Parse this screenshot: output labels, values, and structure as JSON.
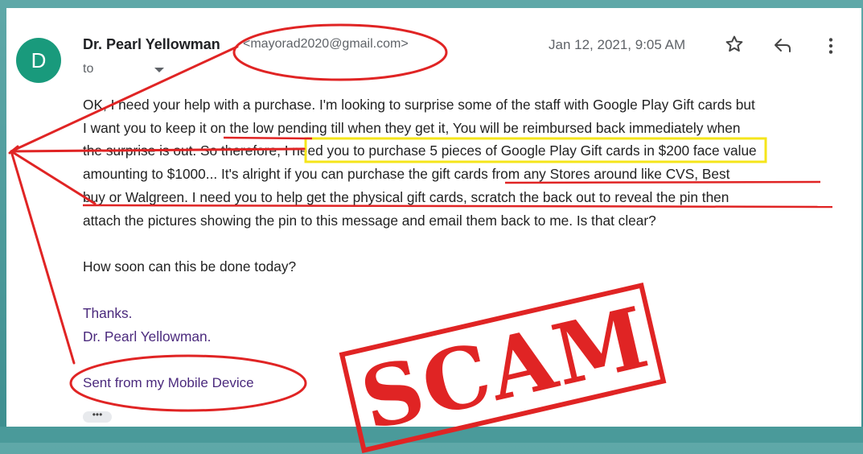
{
  "sender": {
    "avatar_letter": "D",
    "name": "Dr. Pearl Yellowman",
    "email": "<mayorad2020@gmail.com>",
    "to_label": "to"
  },
  "date": "Jan 12, 2021, 9:05 AM",
  "icons": {
    "star": "star-icon",
    "reply": "reply-icon",
    "more": "more-vert-icon"
  },
  "body": {
    "paragraph": "OK, I need your help with a purchase. I'm looking to surprise some of the staff with Google Play Gift cards but\nI want you to keep it on the low pending till when they get it, You will be reimbursed back immediately when\nthe surprise is out. So therefore, I need you to purchase 5 pieces of Google Play Gift cards in $200 face value\namounting to $1000... It's alright if you can purchase the gift  cards from any Stores around like CVS, Best\nbuy or Walgreen. I need you to help get the physical gift cards, scratch the back out to reveal the pin then\nattach the pictures showing the pin to this message and email them back to me. Is that clear?",
    "question": "How soon can this be done today?",
    "thanks": "Thanks.",
    "signature": "Dr. Pearl Yellowman.",
    "sent_from": "Sent from my Mobile Device"
  },
  "ellipsis": "•••",
  "stamp": {
    "text": "SCAM",
    "color": "#e02424"
  },
  "colors": {
    "annotation_red": "#e02424",
    "highlight_yellow": "#f5e51a",
    "avatar_green": "#199a7c",
    "signature_purple": "#4b2a7d"
  }
}
